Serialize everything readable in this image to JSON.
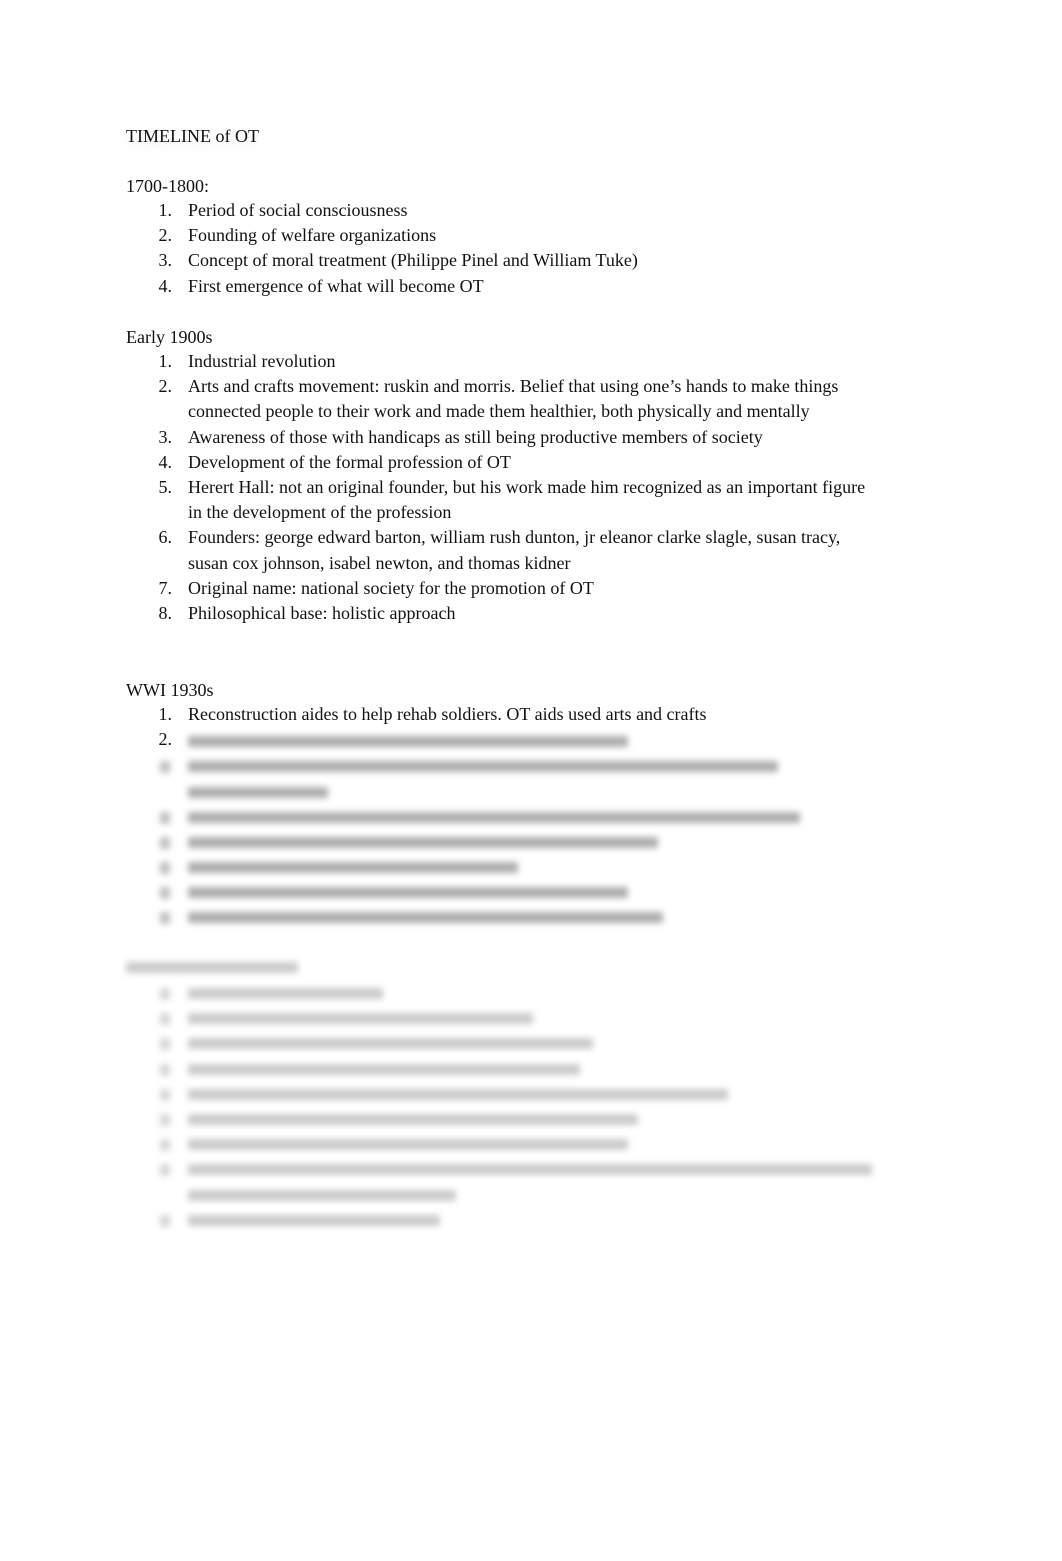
{
  "document": {
    "title": "TIMELINE of OT",
    "sections": [
      {
        "heading": "1700-1800:",
        "items": [
          {
            "num": "1.",
            "text": "Period of social consciousness"
          },
          {
            "num": "2.",
            "text": "Founding of welfare organizations"
          },
          {
            "num": "3.",
            "text": "Concept of moral treatment (Philippe Pinel and William Tuke)"
          },
          {
            "num": "4.",
            "text": "First emergence of what will become OT"
          }
        ]
      },
      {
        "heading": "Early 1900s",
        "items": [
          {
            "num": "1.",
            "text": "Industrial revolution"
          },
          {
            "num": "2.",
            "text": "Arts and crafts movement: ruskin and morris. Belief that using one’s hands to make things connected people to their work and made them healthier, both physically and mentally"
          },
          {
            "num": "3.",
            "text": "Awareness of those with handicaps as still being productive members of society"
          },
          {
            "num": "4.",
            "text": "Development of the formal profession of OT"
          },
          {
            "num": "5.",
            "text": "Herert Hall: not an original founder, but his work made him recognized as an important figure in the development of the profession"
          },
          {
            "num": "6.",
            "text": "Founders: george edward barton, william rush dunton, jr eleanor clarke slagle, susan tracy, susan cox johnson, isabel newton, and thomas kidner"
          },
          {
            "num": "7.",
            "text": "Original name: national society for the promotion of OT"
          },
          {
            "num": "8.",
            "text": "Philosophical base: holistic approach"
          }
        ]
      },
      {
        "heading": "WWI 1930s",
        "items": [
          {
            "num": "1.",
            "text": "Reconstruction aides to help rehab soldiers. OT aids used arts and crafts"
          },
          {
            "num": "2.",
            "text": ""
          }
        ],
        "blurred_items_count": 7
      }
    ],
    "blurred_section": {
      "heading_blurred": true,
      "blurred_items_count": 9
    }
  }
}
